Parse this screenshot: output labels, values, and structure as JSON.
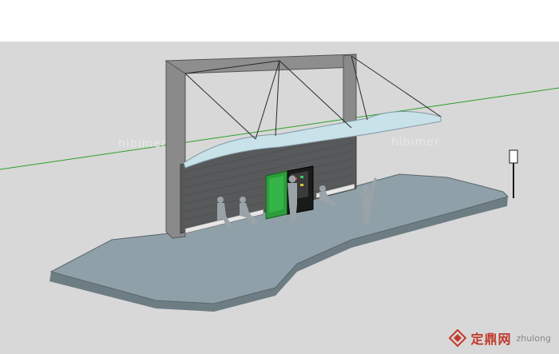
{
  "scene": {
    "description_tag": "3d-bus-stop-model",
    "colors": {
      "background": "#d8d8d8",
      "ground_plate": "#8fa0a8",
      "ground_side": "#6e7d84",
      "wall": "#58595a",
      "frame": "#8a8a8a",
      "roof_glass": "#c9e2ea",
      "vending_green": "#2c9d3a",
      "vending_dark": "#1a1a1a",
      "horizon_line": "#2aa02a"
    }
  },
  "watermarks": {
    "left": "hibimer",
    "right": "hibimer"
  },
  "logo": {
    "text": "定鼎网",
    "domain": "zhulong"
  }
}
